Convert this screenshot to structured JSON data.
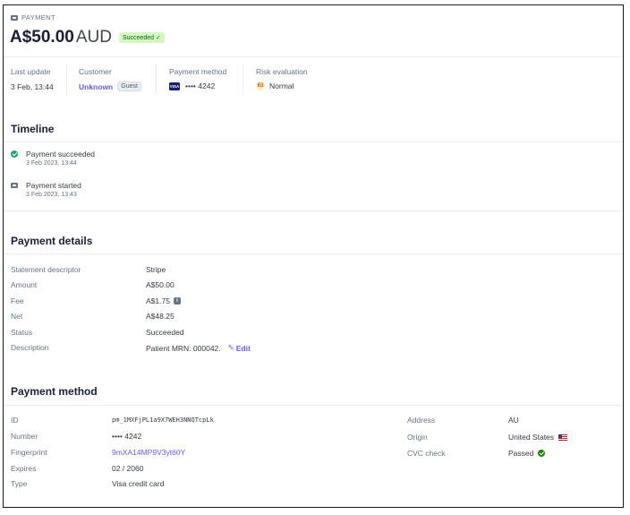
{
  "header": {
    "payment_label": "PAYMENT",
    "amount": "A$50.00",
    "currency": "AUD",
    "status_badge": "Succeeded",
    "check": "✓"
  },
  "summary": {
    "last_update_label": "Last update",
    "last_update_value": "3 Feb, 13:44",
    "customer_label": "Customer",
    "customer_value": "Unknown",
    "guest_badge": "Guest",
    "payment_method_label": "Payment method",
    "card_brand": "VISA",
    "card_masked": "•••• 4242",
    "risk_label": "Risk evaluation",
    "risk_score": "63",
    "risk_value": "Normal"
  },
  "timeline": {
    "title": "Timeline",
    "events": [
      {
        "title": "Payment succeeded",
        "time": "3 Feb 2023, 13:44",
        "icon": "check-circle-icon"
      },
      {
        "title": "Payment started",
        "time": "3 Feb 2023, 13:43",
        "icon": "wallet-icon"
      }
    ]
  },
  "details": {
    "title": "Payment details",
    "rows": [
      {
        "label": "Statement descriptor",
        "value": "Stripe"
      },
      {
        "label": "Amount",
        "value": "A$50.00"
      },
      {
        "label": "Fee",
        "value": "A$1.75"
      },
      {
        "label": "Net",
        "value": "A$48.25"
      },
      {
        "label": "Status",
        "value": "Succeeded"
      },
      {
        "label": "Description",
        "value": "Patient MRN: 000042."
      }
    ],
    "edit_label": "Edit",
    "edit_icon": "✎",
    "info_icon": "i"
  },
  "method": {
    "title": "Payment method",
    "left": [
      {
        "label": "ID",
        "value": "pm_1MXFjPL1a9X7WEH3NNQTcpLk"
      },
      {
        "label": "Number",
        "value": "•••• 4242"
      },
      {
        "label": "Fingerprint",
        "value": "9mXA14MP9V3yt60Y"
      },
      {
        "label": "Expires",
        "value": "02 / 2060"
      },
      {
        "label": "Type",
        "value": "Visa credit card"
      }
    ],
    "right": [
      {
        "label": "Address",
        "value": "AU"
      },
      {
        "label": "Origin",
        "value": "United States"
      },
      {
        "label": "CVC check",
        "value": "Passed"
      }
    ]
  },
  "colors": {
    "accent": "#635bff",
    "success_bg": "#d7f7c2",
    "success_text": "#05690d"
  }
}
